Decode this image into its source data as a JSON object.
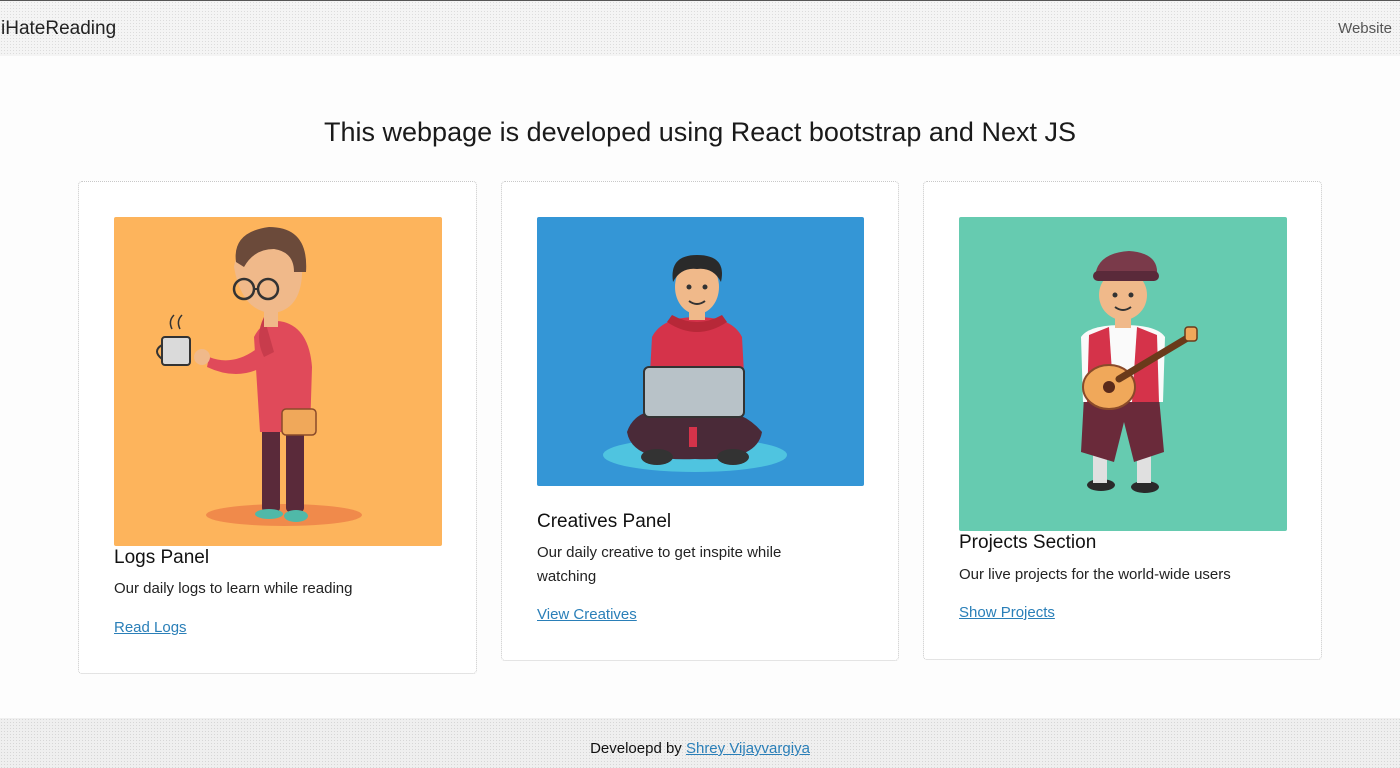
{
  "navbar": {
    "brand": "iHateReading",
    "links": [
      "Website"
    ]
  },
  "headline": "This webpage is developed using React bootstrap and Next JS",
  "cards": [
    {
      "title": "Logs Panel",
      "text": "Our daily logs to learn while reading",
      "link": "Read Logs",
      "image_bg": "#fdb45c",
      "illustration": "person-holding-coffee"
    },
    {
      "title": "Creatives Panel",
      "text": "Our daily creative to get inspite while watching",
      "link": "View Creatives",
      "image_bg": "#3496d6",
      "illustration": "person-with-laptop"
    },
    {
      "title": "Projects Section",
      "text": "Our live projects for the world-wide users",
      "link": "Show Projects",
      "image_bg": "#66cbb0",
      "illustration": "person-playing-guitar"
    }
  ],
  "footer": {
    "text": "Develoepd by",
    "author": "Shrey Vijayvargiya"
  },
  "colors": {
    "link": "#2a7fb8",
    "accent_orange": "#fdb45c",
    "accent_blue": "#3496d6",
    "accent_green": "#66cbb0"
  }
}
